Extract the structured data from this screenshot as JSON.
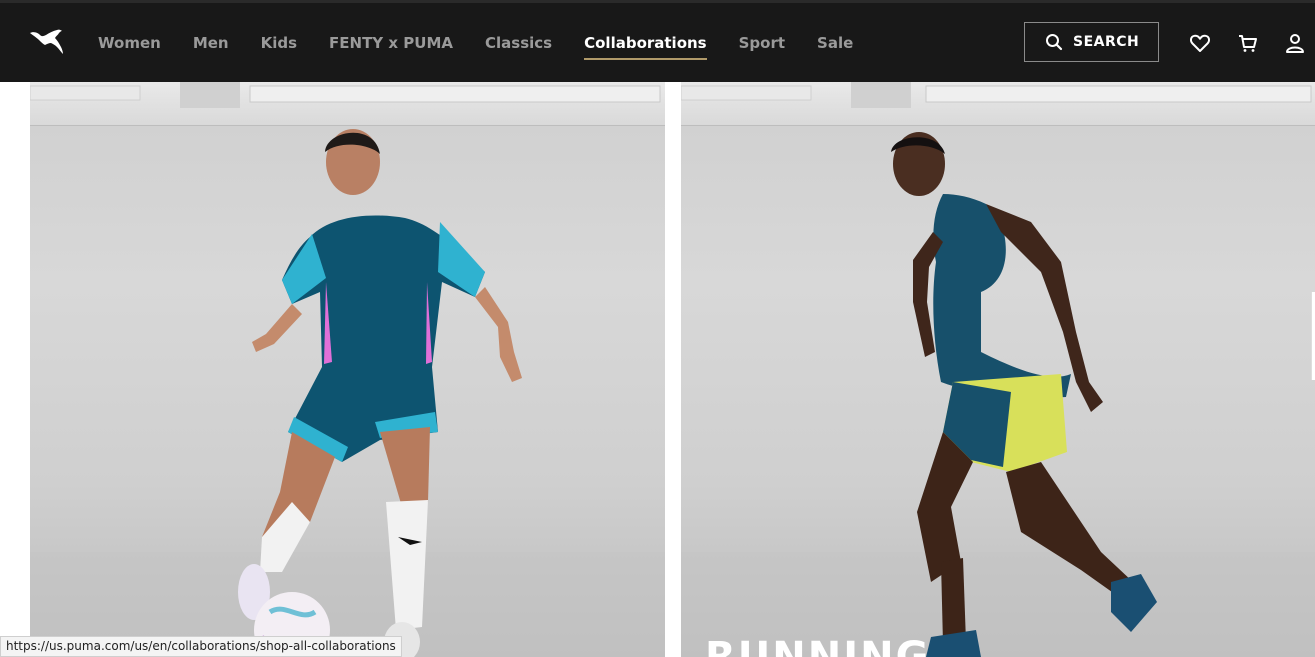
{
  "header": {
    "nav": [
      {
        "label": "Women"
      },
      {
        "label": "Men"
      },
      {
        "label": "Kids"
      },
      {
        "label": "FENTY x PUMA"
      },
      {
        "label": "Classics"
      },
      {
        "label": "Collaborations",
        "active": true
      },
      {
        "label": "Sport"
      },
      {
        "label": "Sale"
      }
    ],
    "search_label": "SEARCH",
    "icons": [
      "puma-logo",
      "search-icon",
      "heart-icon",
      "cart-icon",
      "user-icon"
    ]
  },
  "panels": [
    {
      "name": "football",
      "caption": ""
    },
    {
      "name": "running",
      "caption": "RUNNING"
    }
  ],
  "status": {
    "url": "https://us.puma.com/us/en/collaborations/shop-all-collaborations"
  },
  "colors": {
    "header_bg": "#181818",
    "accent_underline": "#b09a6a",
    "nav_inactive": "#9a9a9a"
  }
}
